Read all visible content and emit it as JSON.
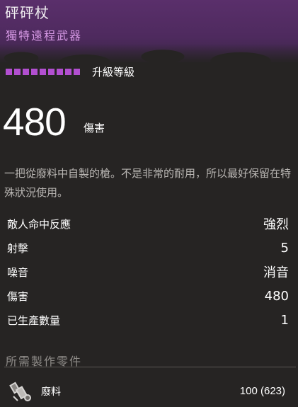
{
  "item": {
    "name": "砰砰杖",
    "rarity": "獨特遠程武器",
    "upgrade_label": "升級等級",
    "upgrade_pips": 9,
    "damage_value": "480",
    "damage_unit": "傷害",
    "description": "一把從廢料中自製的槍。不是非常的耐用，所以最好保留在特殊狀況使用。"
  },
  "stats": [
    {
      "label": "敵人命中反應",
      "value": "強烈"
    },
    {
      "label": "射擊",
      "value": "5"
    },
    {
      "label": "噪音",
      "value": "消音"
    },
    {
      "label": "傷害",
      "value": "480"
    },
    {
      "label": "已生產數量",
      "value": "1"
    }
  ],
  "requirements": {
    "title": "所需製作零件",
    "items": [
      {
        "icon": "scrap-icon",
        "name": "廢料",
        "count": "100 (623)"
      }
    ]
  },
  "colors": {
    "header_bg": "#5a2f6b",
    "rarity_text": "#d89ae6",
    "pip": "#b24fd0",
    "panel_bg": "#262423"
  }
}
